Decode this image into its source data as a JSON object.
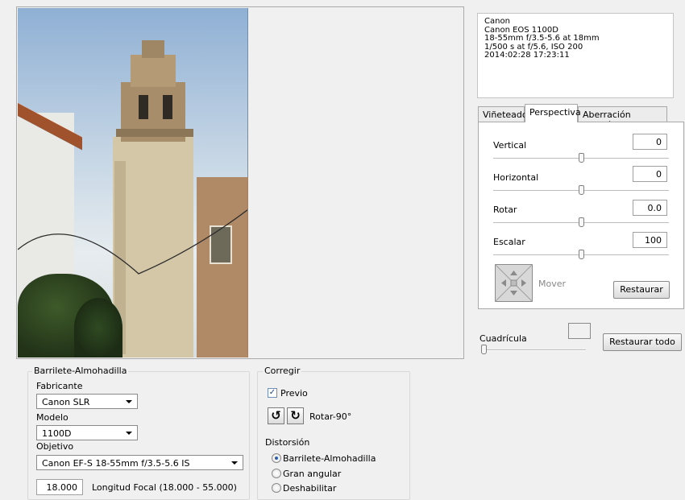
{
  "exif": {
    "text": "Canon\nCanon EOS 1100D\n18-55mm f/3.5-5.6 at 18mm\n1/500 s at f/5.6, ISO 200\n2014:02:28 17:23:11"
  },
  "tabs": [
    {
      "label": "Viñeteado"
    },
    {
      "label": "Perspectiva"
    },
    {
      "label": "Aberración Cromática"
    }
  ],
  "perspective": {
    "vertical": {
      "label": "Vertical",
      "value": "0",
      "position": 0.5
    },
    "horizontal": {
      "label": "Horizontal",
      "value": "0",
      "position": 0.5
    },
    "rotate": {
      "label": "Rotar",
      "value": "0.0",
      "position": 0.5
    },
    "scale": {
      "label": "Escalar",
      "value": "100",
      "position": 0.5
    },
    "move_label": "Mover",
    "reset_label": "Restaurar"
  },
  "grid": {
    "label": "Cuadrícula",
    "reset_all_label": "Restaurar todo",
    "position": 0.0
  },
  "lens": {
    "group_title": "Barrilete-Almohadilla",
    "maker_label": "Fabricante",
    "maker_value": "Canon SLR",
    "model_label": "Modelo",
    "model_value": "1100D",
    "lens_label": "Objetivo",
    "lens_value": "Canon EF-S 18-55mm f/3.5-5.6 IS",
    "focal_value": "18.000",
    "focal_label": "Longitud Focal (18.000 - 55.000)"
  },
  "correct": {
    "group_title": "Corregir",
    "preview_label": "Previo",
    "preview_checked": true,
    "rotate_label": "Rotar-90°",
    "distortion_label": "Distorsión",
    "options": [
      {
        "label": "Barrilete-Almohadilla",
        "checked": true
      },
      {
        "label": "Gran angular",
        "checked": false
      },
      {
        "label": "Deshabilitar",
        "checked": false
      }
    ]
  },
  "colors": {
    "accent": "#2a5db0",
    "panel_bg": "#f0f0f0"
  },
  "icons": [
    "rotate-left-icon",
    "rotate-right-icon",
    "move-pad-icon",
    "checkmark-icon",
    "dropdown-arrow-icon"
  ]
}
